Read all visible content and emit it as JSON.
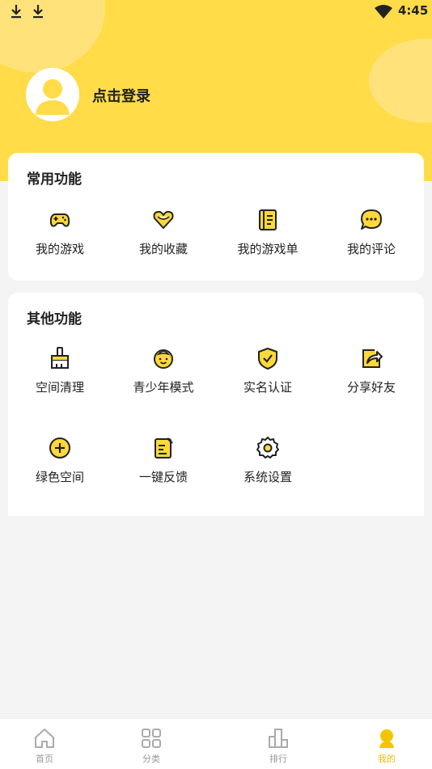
{
  "status_bar": {
    "time": "4:45",
    "icons": [
      "download-icon",
      "download-icon",
      "wifi-icon"
    ]
  },
  "profile": {
    "login_label": "点击登录",
    "avatar_icon": "user-avatar-icon"
  },
  "common_functions": {
    "title": "常用功能",
    "items": [
      {
        "label": "我的游戏",
        "icon": "gamepad-icon"
      },
      {
        "label": "我的收藏",
        "icon": "heart-icon"
      },
      {
        "label": "我的游戏单",
        "icon": "list-icon"
      },
      {
        "label": "我的评论",
        "icon": "comment-icon"
      }
    ]
  },
  "other_functions": {
    "title": "其他功能",
    "items": [
      {
        "label": "空间清理",
        "icon": "broom-icon"
      },
      {
        "label": "青少年模式",
        "icon": "child-face-icon"
      },
      {
        "label": "实名认证",
        "icon": "shield-check-icon"
      },
      {
        "label": "分享好友",
        "icon": "share-icon"
      },
      {
        "label": "绿色空间",
        "icon": "plus-circle-icon"
      },
      {
        "label": "一键反馈",
        "icon": "feedback-icon"
      },
      {
        "label": "系统设置",
        "icon": "gear-icon"
      }
    ]
  },
  "tabbar": {
    "tabs": [
      {
        "label": "首页",
        "icon": "home-icon",
        "active": false
      },
      {
        "label": "分类",
        "icon": "category-icon",
        "active": false
      },
      {
        "label": "排行",
        "icon": "ranking-icon",
        "active": false
      },
      {
        "label": "我的",
        "icon": "profile-icon",
        "active": true
      }
    ]
  },
  "colors": {
    "header_yellow": "#ffdc48",
    "accent_yellow": "#ffd83a",
    "active_tab": "#f5b800",
    "icon_stroke": "#222222"
  }
}
